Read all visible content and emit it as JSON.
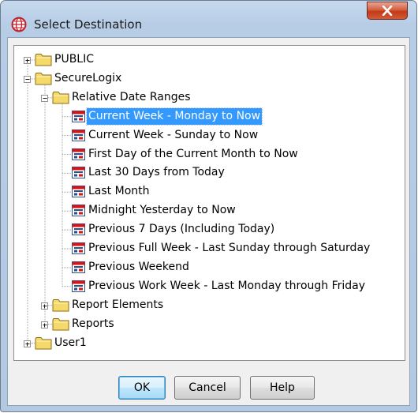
{
  "window": {
    "title": "Select Destination",
    "app_icon": "globe-icon",
    "close_icon": "close-icon"
  },
  "tree": {
    "nodes": [
      {
        "label": "PUBLIC",
        "depth": 0,
        "kind": "folder",
        "expanded": false
      },
      {
        "label": "SecureLogix",
        "depth": 0,
        "kind": "folder",
        "expanded": true
      },
      {
        "label": "Relative Date Ranges",
        "depth": 1,
        "kind": "folder",
        "expanded": true
      },
      {
        "label": "Current Week - Monday to Now",
        "depth": 2,
        "kind": "report",
        "selected": true
      },
      {
        "label": "Current Week - Sunday to Now",
        "depth": 2,
        "kind": "report"
      },
      {
        "label": "First Day of the Current Month to Now",
        "depth": 2,
        "kind": "report"
      },
      {
        "label": "Last 30 Days from Today",
        "depth": 2,
        "kind": "report"
      },
      {
        "label": "Last Month",
        "depth": 2,
        "kind": "report"
      },
      {
        "label": "Midnight Yesterday to Now",
        "depth": 2,
        "kind": "report"
      },
      {
        "label": "Previous 7 Days (Including Today)",
        "depth": 2,
        "kind": "report"
      },
      {
        "label": "Previous Full Week - Last Sunday through Saturday",
        "depth": 2,
        "kind": "report"
      },
      {
        "label": "Previous Weekend",
        "depth": 2,
        "kind": "report"
      },
      {
        "label": "Previous Work Week - Last Monday through Friday",
        "depth": 2,
        "kind": "report"
      },
      {
        "label": "Report Elements",
        "depth": 1,
        "kind": "folder",
        "expanded": false
      },
      {
        "label": "Reports",
        "depth": 1,
        "kind": "folder",
        "expanded": false
      },
      {
        "label": "User1",
        "depth": 0,
        "kind": "folder",
        "expanded": false
      }
    ]
  },
  "buttons": {
    "ok": "OK",
    "cancel": "Cancel",
    "help": "Help"
  },
  "colors": {
    "selection": "#3399ff",
    "folder": "#f5d96b",
    "report_icon_accent": "#d01818"
  }
}
